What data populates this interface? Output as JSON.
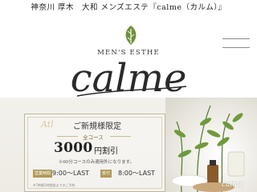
{
  "header": {
    "site_title": "神奈川 厚木　大和 メンズエステ『calme（カルム）』"
  },
  "logo": {
    "subtitle": "MEN'S ESTHE",
    "wordmark": "calme",
    "leaf_icon": "leaf-icon"
  },
  "nav": {
    "menu_icon": "hamburger-menu-icon"
  },
  "banner": {
    "script_text": "Atl",
    "headline": "ご新規様限定",
    "course_label": "全コース",
    "price": "3000",
    "price_unit": "円割引",
    "note": "※60分コースのみ適用外になります。",
    "tag1": "営業時間",
    "hours1": "9:00～LAST",
    "tag2": "受付",
    "hours2": "8:00～LAST",
    "fineprint": "※7時間1時間前までのご予約",
    "corner_logo": "calme"
  },
  "colors": {
    "gold": "#b19a58",
    "leaf_green": "#6f8f3a",
    "text_dark": "#222222"
  }
}
